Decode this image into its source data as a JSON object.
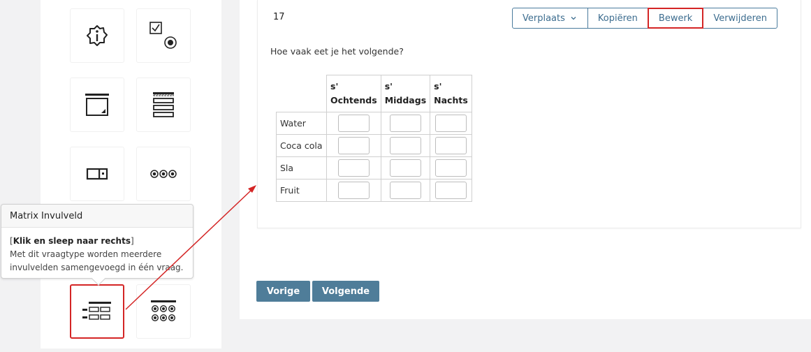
{
  "palette": {
    "tiles": [
      {
        "icon": "info-icon"
      },
      {
        "icon": "checkbox-radio-icon"
      },
      {
        "icon": "textarea-icon"
      },
      {
        "icon": "stacked-fields-icon"
      },
      {
        "icon": "input-field-icon"
      },
      {
        "icon": "radio-row-icon"
      },
      {
        "icon": "matrix-input-icon",
        "selected": true
      },
      {
        "icon": "matrix-radio-icon"
      }
    ]
  },
  "tooltip": {
    "title": "Matrix Invulveld",
    "bracket_open": "[",
    "instruction": "Klik en sleep naar rechts",
    "bracket_close": "]",
    "description": "Met dit vraagtype worden meerdere invulvelden samengevoegd in één vraag."
  },
  "question": {
    "number": "17",
    "text": "Hoe vaak eet je het volgende?",
    "actions": {
      "move": "Verplaats",
      "copy": "Kopiëren",
      "edit": "Bewerk",
      "delete": "Verwijderen"
    },
    "matrix": {
      "columns": [
        {
          "line1": "s'",
          "line2": "Ochtends"
        },
        {
          "line1": "s'",
          "line2": "Middags"
        },
        {
          "line1": "s'",
          "line2": "Nachts"
        }
      ],
      "rows": [
        "Water",
        "Coca cola",
        "Sla",
        "Fruit"
      ]
    }
  },
  "navigation": {
    "previous": "Vorige",
    "next": "Volgende"
  },
  "colors": {
    "accent": "#4f7d99",
    "highlight": "#d42525",
    "button_border": "#4a7b9d"
  }
}
